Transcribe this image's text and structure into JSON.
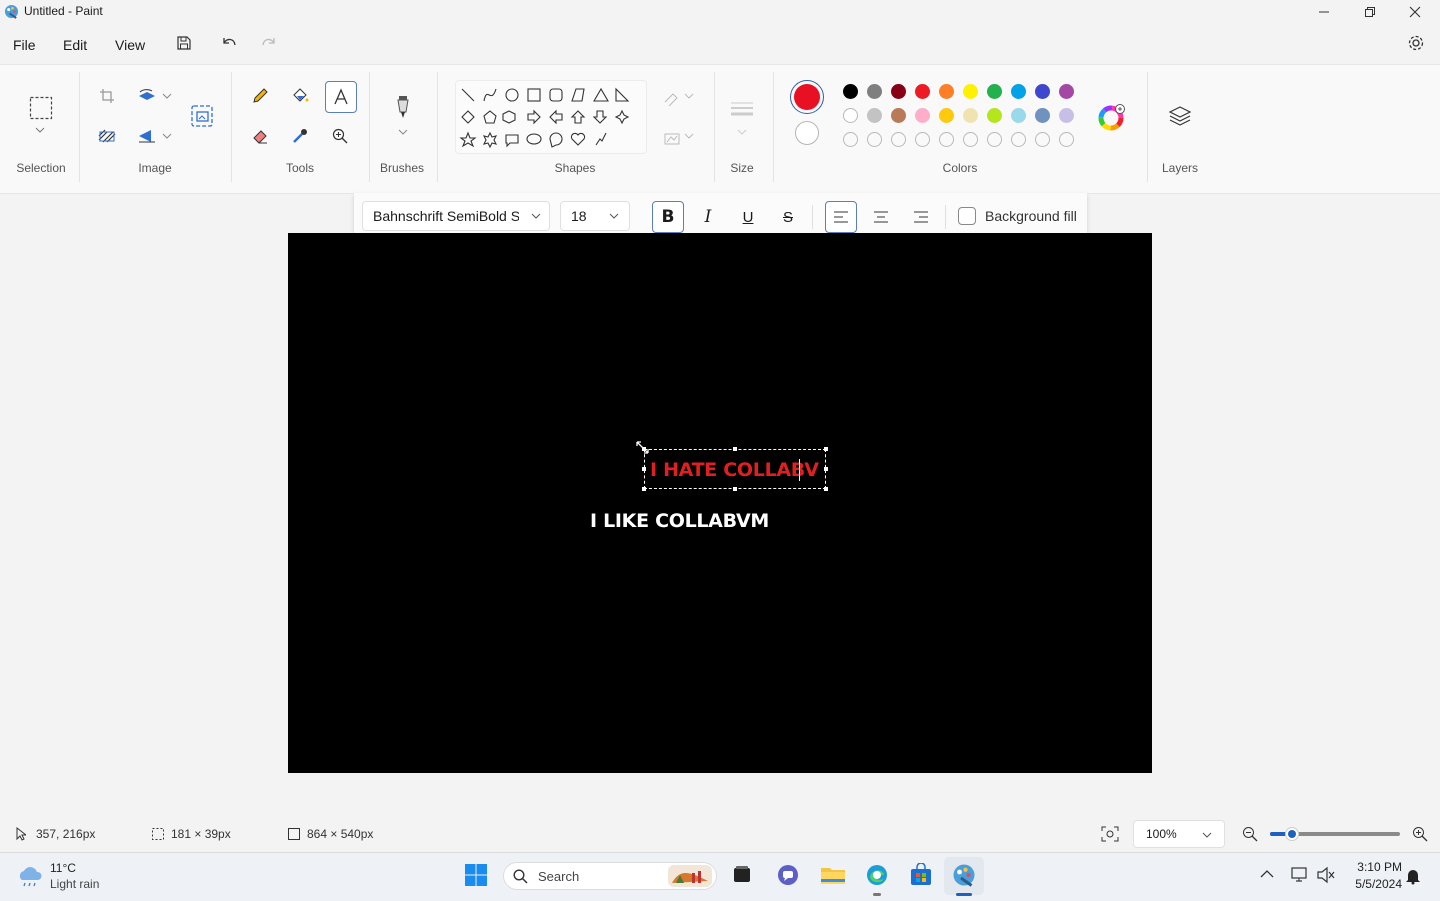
{
  "window": {
    "title": "Untitled - Paint",
    "controls": [
      "minimize",
      "restore",
      "close"
    ]
  },
  "menu": {
    "items": [
      {
        "label": "File"
      },
      {
        "label": "Edit"
      },
      {
        "label": "View"
      }
    ],
    "icons": [
      "save-icon",
      "undo-icon",
      "redo-icon",
      "settings-icon"
    ]
  },
  "ribbon": {
    "groups": [
      {
        "label": "Selection"
      },
      {
        "label": "Image"
      },
      {
        "label": "Tools"
      },
      {
        "label": "Brushes"
      },
      {
        "label": "Shapes"
      },
      {
        "label": "Size"
      },
      {
        "label": "Colors"
      },
      {
        "label": "Layers"
      }
    ],
    "active_tool": "text-tool",
    "primary_color": "#e81123",
    "secondary_color": "#ffffff",
    "palette": [
      [
        "#000000",
        "#7f7f7f",
        "#880015",
        "#ed1c24",
        "#ff7f27",
        "#fff200",
        "#22b14c",
        "#00a2e8",
        "#3f48cc",
        "#a349a4"
      ],
      [
        "#ffffff",
        "#c3c3c3",
        "#b97a57",
        "#ffaec9",
        "#ffc90e",
        "#efe4b0",
        "#b5e61d",
        "#99d9ea",
        "#7092be",
        "#c8bfe7"
      ]
    ]
  },
  "text_toolbar": {
    "font_family": "Bahnschrift SemiBold S",
    "font_size": "18",
    "bold": true,
    "italic": false,
    "underline": false,
    "strikethrough": false,
    "alignment": "left",
    "background_fill_label": "Background fill",
    "background_fill_checked": false
  },
  "canvas": {
    "background": "#000000",
    "text_box_content": "I HATE COLLABV",
    "text_box_color": "#e02020",
    "placed_text": "I LIKE COLLABVM",
    "placed_text_color": "#ffffff"
  },
  "status": {
    "cursor_position": "357, 216px",
    "selection_size": "181 × 39px",
    "canvas_size": "864 × 540px",
    "zoom": "100%"
  },
  "taskbar": {
    "weather_temp": "11°C",
    "weather_desc": "Light rain",
    "search_label": "Search",
    "time": "3:10 PM",
    "date": "5/5/2024"
  }
}
